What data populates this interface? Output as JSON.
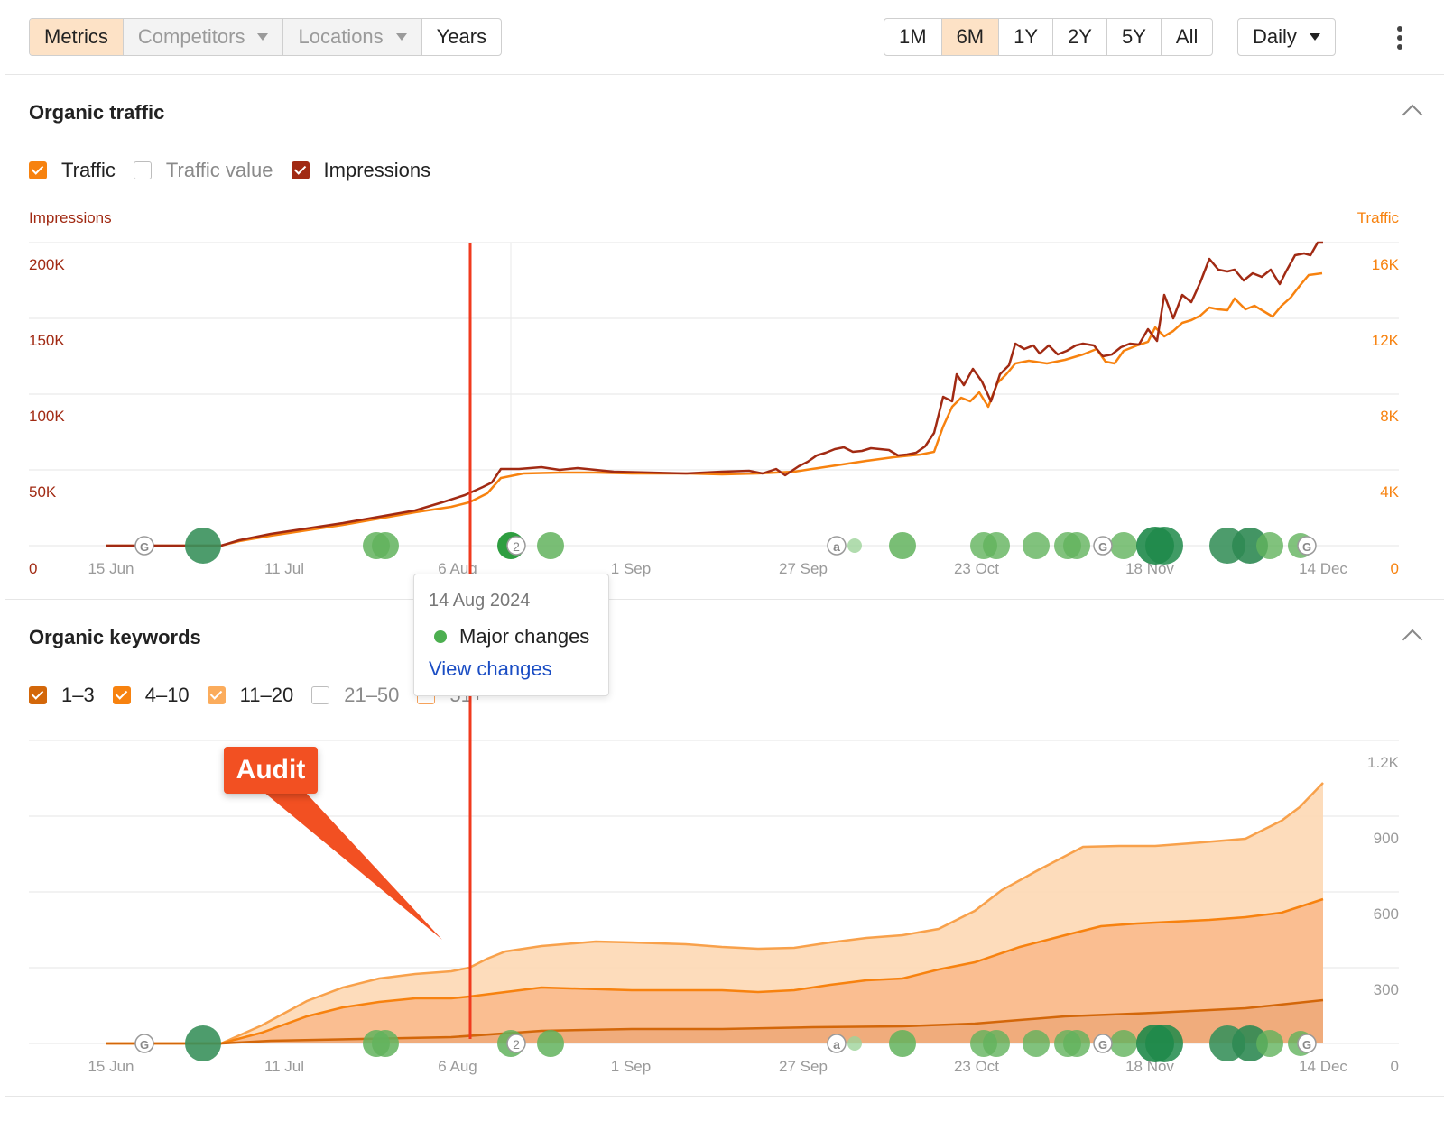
{
  "toolbar": {
    "left_tabs": [
      {
        "label": "Metrics"
      },
      {
        "label": "Competitors"
      },
      {
        "label": "Locations"
      },
      {
        "label": "Years"
      }
    ],
    "ranges": [
      "1M",
      "6M",
      "1Y",
      "2Y",
      "5Y",
      "All"
    ],
    "active_range": "6M",
    "interval": "Daily"
  },
  "organic_traffic": {
    "title": "Organic traffic",
    "legend": [
      {
        "label": "Traffic",
        "checked": true,
        "color": "#f7820f"
      },
      {
        "label": "Traffic value",
        "checked": false,
        "color": "#bdbdbd"
      },
      {
        "label": "Impressions",
        "checked": true,
        "color": "#a12a13"
      }
    ],
    "left_axis_title": "Impressions",
    "right_axis_title": "Traffic",
    "left_ticks": [
      "200K",
      "150K",
      "100K",
      "50K",
      "0"
    ],
    "right_ticks": [
      "16K",
      "12K",
      "8K",
      "4K",
      "0"
    ],
    "x_ticks": [
      "15 Jun",
      "11 Jul",
      "6 Aug",
      "1 Sep",
      "27 Sep",
      "23 Oct",
      "18 Nov",
      "14 Dec"
    ]
  },
  "organic_keywords": {
    "title": "Organic keywords",
    "legend": [
      {
        "label": "1–3",
        "checked": true,
        "color": "#d3670a"
      },
      {
        "label": "4–10",
        "checked": true,
        "color": "#f7820f"
      },
      {
        "label": "11–20",
        "checked": true,
        "color": "#fbac5c"
      },
      {
        "label": "21–50",
        "checked": false,
        "color": "#bdbdbd"
      },
      {
        "label": "51+",
        "checked": false,
        "color": "#f7a35c"
      }
    ],
    "right_ticks": [
      "1.2K",
      "900",
      "600",
      "300",
      "0"
    ],
    "x_ticks": [
      "15 Jun",
      "11 Jul",
      "6 Aug",
      "1 Sep",
      "27 Sep",
      "23 Oct",
      "18 Nov",
      "14 Dec"
    ]
  },
  "tooltip": {
    "date": "14 Aug 2024",
    "item": "Major changes",
    "link": "View changes",
    "dot_color": "#4caf50"
  },
  "annotation": {
    "label": "Audit",
    "color": "#f25022"
  },
  "event_markers": {
    "google_letter": "G",
    "a_letter": "a",
    "count_label": "2"
  },
  "chart_data": [
    {
      "type": "line",
      "title": "Organic traffic",
      "x": [
        "15 Jun",
        "11 Jul",
        "6 Aug",
        "1 Sep",
        "27 Sep",
        "23 Oct",
        "18 Nov",
        "14 Dec"
      ],
      "series": [
        {
          "name": "Impressions",
          "axis": "left",
          "values": [
            0,
            10000,
            30000,
            50000,
            51000,
            85000,
            125000,
            200000
          ]
        },
        {
          "name": "Traffic",
          "axis": "right",
          "values": [
            0,
            800,
            2400,
            4000,
            4100,
            6400,
            10000,
            15000
          ]
        }
      ],
      "ylabel": "Impressions",
      "y2label": "Traffic",
      "ylim": [
        0,
        200000
      ],
      "y2lim": [
        0,
        16000
      ],
      "grid": true
    },
    {
      "type": "area",
      "title": "Organic keywords",
      "x": [
        "15 Jun",
        "11 Jul",
        "6 Aug",
        "1 Sep",
        "27 Sep",
        "23 Oct",
        "18 Nov",
        "14 Dec"
      ],
      "series": [
        {
          "name": "1–3",
          "values": [
            0,
            5,
            15,
            20,
            22,
            40,
            70,
            140
          ]
        },
        {
          "name": "4–10",
          "values": [
            0,
            60,
            140,
            170,
            170,
            250,
            420,
            580
          ]
        },
        {
          "name": "11–20",
          "values": [
            0,
            120,
            260,
            360,
            340,
            450,
            780,
            1020
          ]
        }
      ],
      "ylim": [
        0,
        1200
      ],
      "grid": true
    }
  ]
}
